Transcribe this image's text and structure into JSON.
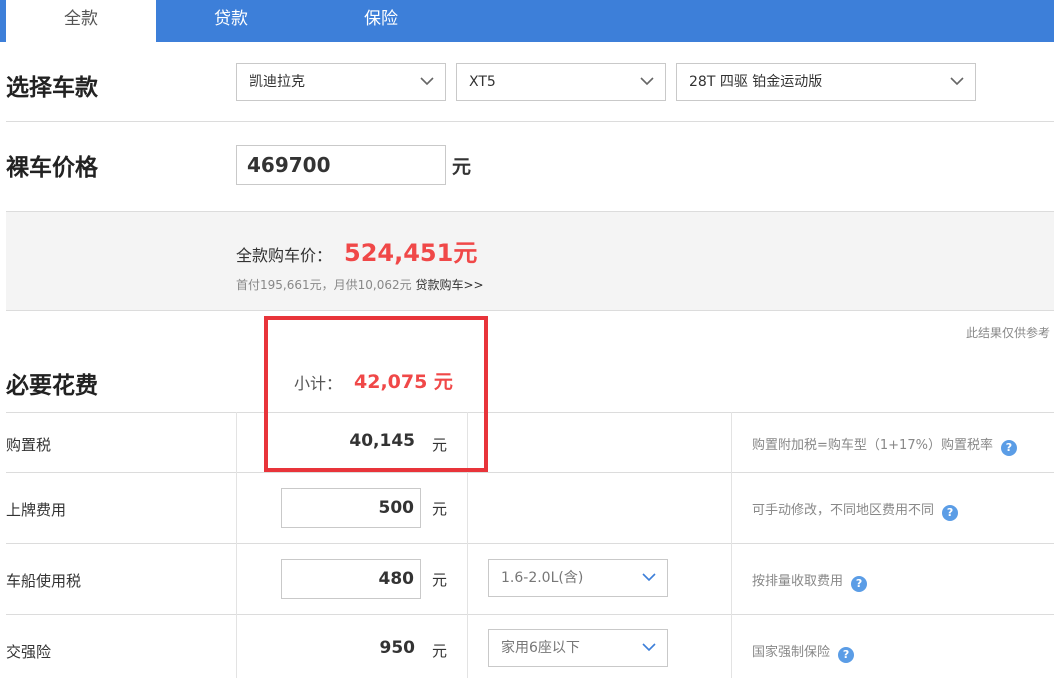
{
  "tabs": [
    {
      "label": "全款",
      "active": true
    },
    {
      "label": "贷款",
      "active": false
    },
    {
      "label": "保险",
      "active": false
    }
  ],
  "select_car": {
    "title": "选择车款",
    "brand": "凯迪拉克",
    "model": "XT5",
    "trim": "28T 四驱 铂金运动版"
  },
  "bare_price": {
    "title": "裸车价格",
    "value": "469700",
    "unit": "元"
  },
  "summary": {
    "label": "全款购车价：",
    "value": "524,451元",
    "sub_text": "首付195,661元，月供10,062元 ",
    "loan_link": "贷款购车>>"
  },
  "note": "此结果仅供参考",
  "required": {
    "title": "必要花费",
    "subtotal_label": "小计：",
    "subtotal_value": "42,075 元",
    "rows": [
      {
        "label": "购置税",
        "value": "40,145",
        "unit": "元",
        "desc": "购置附加税=购车型（1+17%）购置税率"
      },
      {
        "label": "上牌费用",
        "value": "500",
        "unit": "元",
        "desc": "可手动修改，不同地区费用不同"
      },
      {
        "label": "车船使用税",
        "value": "480",
        "unit": "元",
        "option": "1.6-2.0L(含)",
        "desc": "按排量收取费用"
      },
      {
        "label": "交强险",
        "value": "950",
        "unit": "元",
        "option": "家用6座以下",
        "desc": "国家强制保险"
      }
    ]
  },
  "icons": {
    "help": "help-icon",
    "dropdown": "chevron-down-icon"
  },
  "colors": {
    "tab_bar": "#3d7fd9",
    "price_red": "#f04848",
    "highlight_red": "#e8343a",
    "help_blue": "#5b9de6"
  },
  "glyphs": {
    "help": "?"
  }
}
